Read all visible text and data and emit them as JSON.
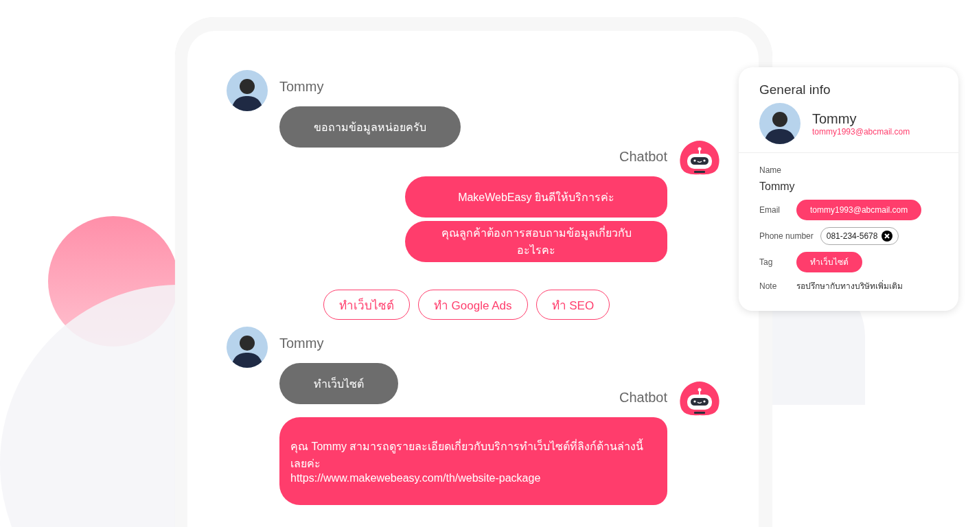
{
  "chat": [
    {
      "kind": "user",
      "name": "Tommy",
      "bubbles": [
        {
          "text": "ขอถามข้อมูลหน่อยครับ"
        }
      ]
    },
    {
      "kind": "bot",
      "name": "Chatbot",
      "bubbles": [
        {
          "text": "MakeWebEasy ยินดีให้บริการค่ะ"
        },
        {
          "text": "คุณลูกค้าต้องการสอบถามข้อมูลเกี่ยวกับอะไรคะ"
        }
      ]
    },
    {
      "kind": "quick_replies",
      "options": [
        "ทำเว็บไซต์",
        "ทำ Google Ads",
        "ทำ SEO"
      ]
    },
    {
      "kind": "user",
      "name": "Tommy",
      "bubbles": [
        {
          "text": "ทำเว็บไซต์"
        }
      ]
    },
    {
      "kind": "bot",
      "name": "Chatbot",
      "bubbles": [
        {
          "text": "คุณ Tommy สามารถดูรายละเอียดเกี่ยวกับบริการทำเว็บไซต์ที่ลิงก์ด้านล่างนี้เลยค่ะ",
          "link": "https://www.makewebeasy.com/th/website-package"
        }
      ]
    }
  ],
  "info_card": {
    "title": "General info",
    "profile": {
      "name": "Tommy",
      "email": "tommy1993@abcmail.com"
    },
    "fields": [
      {
        "kind": "stacked",
        "label": "Name",
        "value": "Tommy"
      },
      {
        "kind": "pill",
        "label": "Email",
        "value": "tommy1993@abcmail.com"
      },
      {
        "kind": "chip",
        "label": "Phone number",
        "value": "081-234-5678"
      },
      {
        "kind": "pill",
        "label": "Tag",
        "value": "ทำเว็บไซต์"
      },
      {
        "kind": "plain",
        "label": "Note",
        "value": "รอปรึกษากับทางบริษัทเพิ่มเติม"
      }
    ]
  }
}
